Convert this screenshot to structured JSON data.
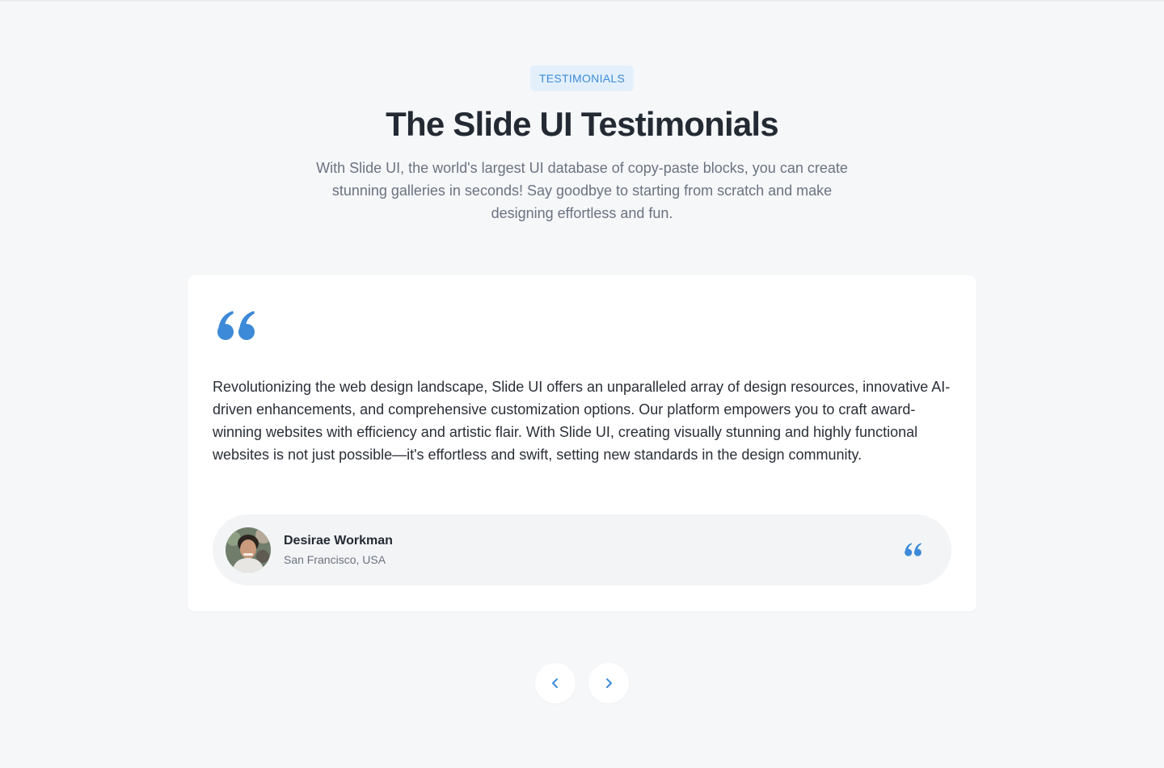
{
  "header": {
    "badge": "TESTIMONIALS",
    "title": "The Slide UI Testimonials",
    "subtitle": "With Slide UI, the world's largest UI database of copy-paste blocks, you can create stunning galleries in seconds! Say goodbye to starting from scratch and make designing effortless and fun."
  },
  "testimonial": {
    "quote_icon": "quote-mark-icon",
    "text": "Revolutionizing the web design landscape, Slide UI offers an unparalleled array of design resources, innovative AI-driven enhancements, and comprehensive customization options. Our platform empowers you to craft award-winning websites with efficiency and artistic flair. With Slide UI, creating visually stunning and highly functional websites is not just possible—it's effortless and swift, setting new standards in the design community.",
    "author": {
      "name": "Desirae Workman",
      "location": "San Francisco, USA"
    }
  },
  "navigation": {
    "prev_icon": "chevron-left-icon",
    "next_icon": "chevron-right-icon"
  },
  "colors": {
    "background": "#f6f7f9",
    "accent": "#3d8ad8",
    "badge_background": "#e3f0fc",
    "card": "#ffffff",
    "author_panel": "#f3f4f6",
    "heading": "#242a33",
    "muted_text": "#6b7280"
  }
}
